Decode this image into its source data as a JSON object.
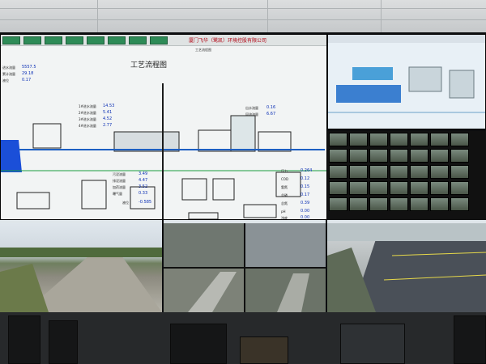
{
  "scada": {
    "title": "厦门飞华（鹭凯）环境控股有限公司",
    "subtitle": "工艺流程图",
    "toolbar_caption": "工艺流程图",
    "values": [
      {
        "label": "1#进水流量",
        "value": "14.53"
      },
      {
        "label": "2#进水流量",
        "value": "5.41"
      },
      {
        "label": "3#进水流量",
        "value": "4.52"
      },
      {
        "label": "4#进水流量",
        "value": "2.77"
      },
      {
        "label": "出水流量",
        "value": "0.16"
      },
      {
        "label": "回流流量",
        "value": "6.67"
      },
      {
        "label": "污泥流量",
        "value": "3.49"
      },
      {
        "label": "排泥流量",
        "value": "4.47"
      },
      {
        "label": "加药流量",
        "value": "3.52"
      },
      {
        "label": "曝气量",
        "value": "0.33"
      },
      {
        "label": "液位",
        "value": "-0.585"
      },
      {
        "label": "压力",
        "value": "0.264"
      },
      {
        "label": "COD",
        "value": "0.12"
      },
      {
        "label": "氨氮",
        "value": "0.15"
      },
      {
        "label": "总磷",
        "value": "0.17"
      },
      {
        "label": "总氮",
        "value": "0.39"
      },
      {
        "label": "pH",
        "value": "0.00"
      },
      {
        "label": "浊度",
        "value": "0.00"
      }
    ],
    "left_values": [
      {
        "label": "进水流量",
        "value": "5557.5"
      },
      {
        "label": "累计流量",
        "value": "29.18"
      },
      {
        "label": "液位",
        "value": "0.17"
      }
    ]
  },
  "scene": {
    "type": "control room video wall",
    "colors": {
      "scada_bg": "#f2f4f4",
      "toolbar_button": "#2e8b57",
      "value_text": "#0b2fb5",
      "title_text": "#b00010"
    }
  }
}
